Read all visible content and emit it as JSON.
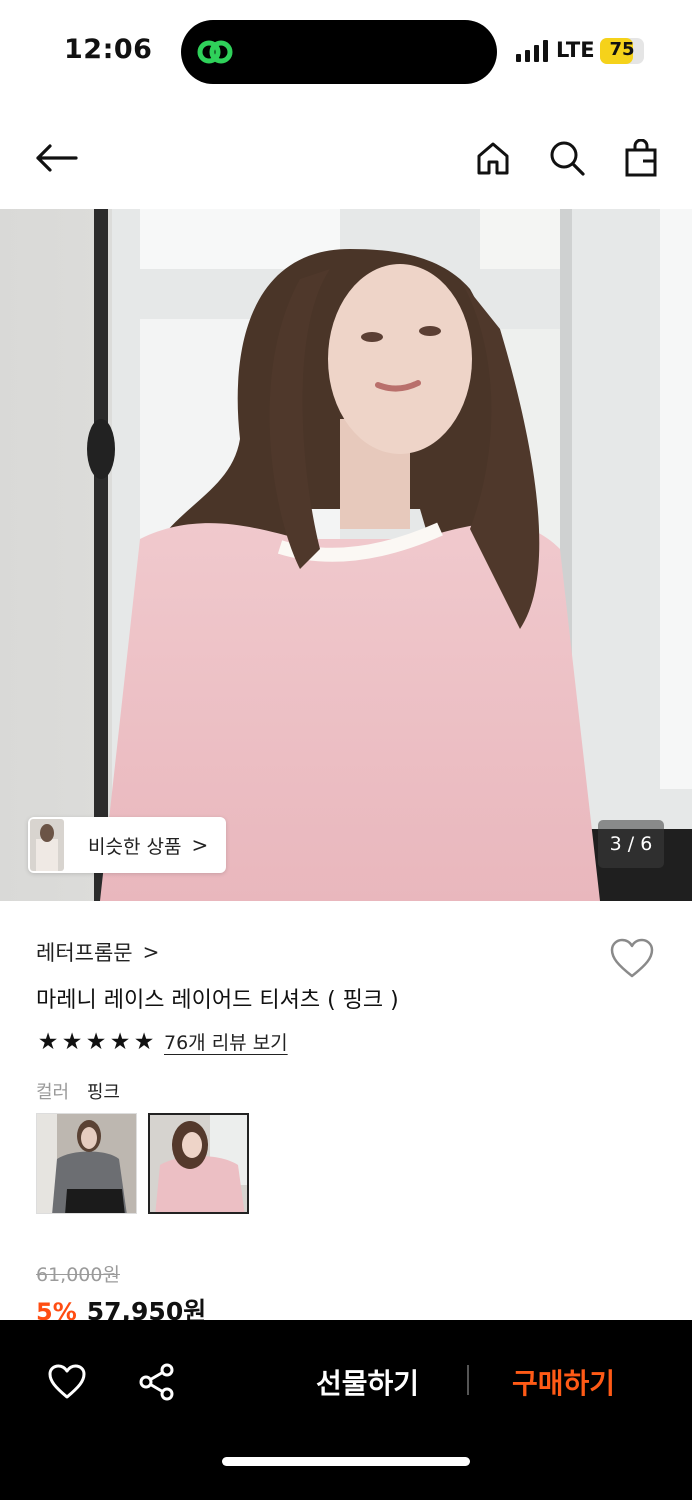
{
  "status_bar": {
    "time": "12:06",
    "network": "LTE",
    "battery": "75",
    "battery_level": 0.75,
    "battery_color": "#f5d21a"
  },
  "nav": {
    "back_icon": "arrow-left-icon",
    "home_icon": "home-icon",
    "search_icon": "search-icon",
    "bag_icon": "shopping-bag-icon"
  },
  "gallery": {
    "similar_label": "비슷한 상품",
    "similar_chevron": ">",
    "counter": "3 / 6"
  },
  "product": {
    "brand": "레터프롬문",
    "brand_chevron": ">",
    "title": "마레니 레이스 레이어드 티셔츠 ( 핑크 )",
    "rating": 5,
    "reviews_label": "76개 리뷰 보기",
    "color_label": "컬러",
    "color_value": "핑크",
    "swatches": [
      {
        "name": "gray",
        "selected": false
      },
      {
        "name": "pink",
        "selected": true
      }
    ],
    "original_price": "61,000원",
    "discount": "5%",
    "price": "57,950원"
  },
  "bottom_bar": {
    "wishlist_icon": "heart-icon",
    "share_icon": "share-icon",
    "gift_label": "선물하기",
    "buy_label": "구매하기",
    "buy_color": "#ff5a16"
  }
}
